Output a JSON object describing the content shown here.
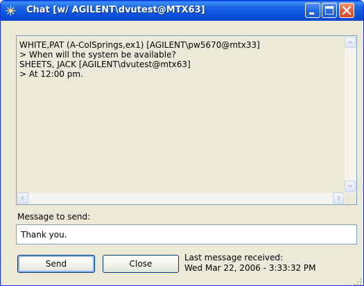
{
  "window": {
    "title": "Chat [w/ AGILENT\\dvutest@MTX63]"
  },
  "chat": {
    "lines": [
      "WHITE,PAT (A-ColSprings,ex1) [AGILENT\\pw5670@mtx33]",
      "> When will the system be available?",
      "SHEETS, JACK [AGILENT\\dvutest@mtx63]",
      "> At 12:00 pm."
    ]
  },
  "compose": {
    "label": "Message to send:",
    "value": "Thank you."
  },
  "buttons": {
    "send": "Send",
    "close": "Close"
  },
  "status": {
    "last_label": "Last message received:",
    "last_value": "Wed Mar 22, 2006 - 3:33:32 PM"
  },
  "icons": {
    "title_icon": "agilent-spark-icon",
    "minimize": "minimize-icon",
    "maximize": "maximize-icon",
    "close": "close-icon"
  },
  "colors": {
    "titlebar": "#0a4ad6",
    "window_bg": "#ece9d8",
    "border": "#7f9db9",
    "close_button": "#e4643f"
  }
}
